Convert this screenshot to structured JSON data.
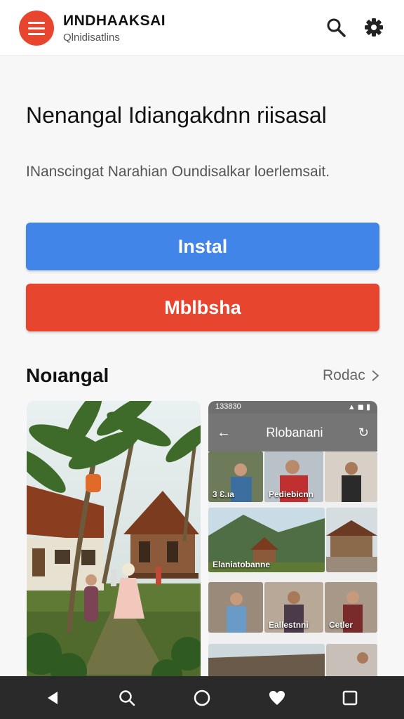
{
  "appbar": {
    "title": "ИNDHAAKSAI",
    "subtitle": "Qlnidisatlins",
    "menu_icon": "hamburger-menu-icon",
    "search_icon": "search-icon",
    "settings_icon": "gear-icon"
  },
  "main": {
    "headline": "Nenangal Idiangakdnn riisasal",
    "description": "INanscingat Narahian Oundisalkar loerlemsait.",
    "install_label": "Instal",
    "second_label": "Mblbsha",
    "section_title": "Noıangal",
    "section_more": "Rodac"
  },
  "phone": {
    "time": "133830",
    "title": "Rlobanani",
    "thumb_labels": [
      "3 Ɛ.ıa",
      "Pediebicnn",
      "",
      "Elaniatobanne",
      "",
      "Eallestnni",
      "Cetler"
    ]
  },
  "navbar": {
    "icons": [
      "back-icon",
      "search-icon",
      "home-icon",
      "heart-icon",
      "recents-icon"
    ]
  },
  "colors": {
    "accent_red": "#e8452e",
    "accent_blue": "#4285e8",
    "nav_bg": "#2a2a2a"
  }
}
